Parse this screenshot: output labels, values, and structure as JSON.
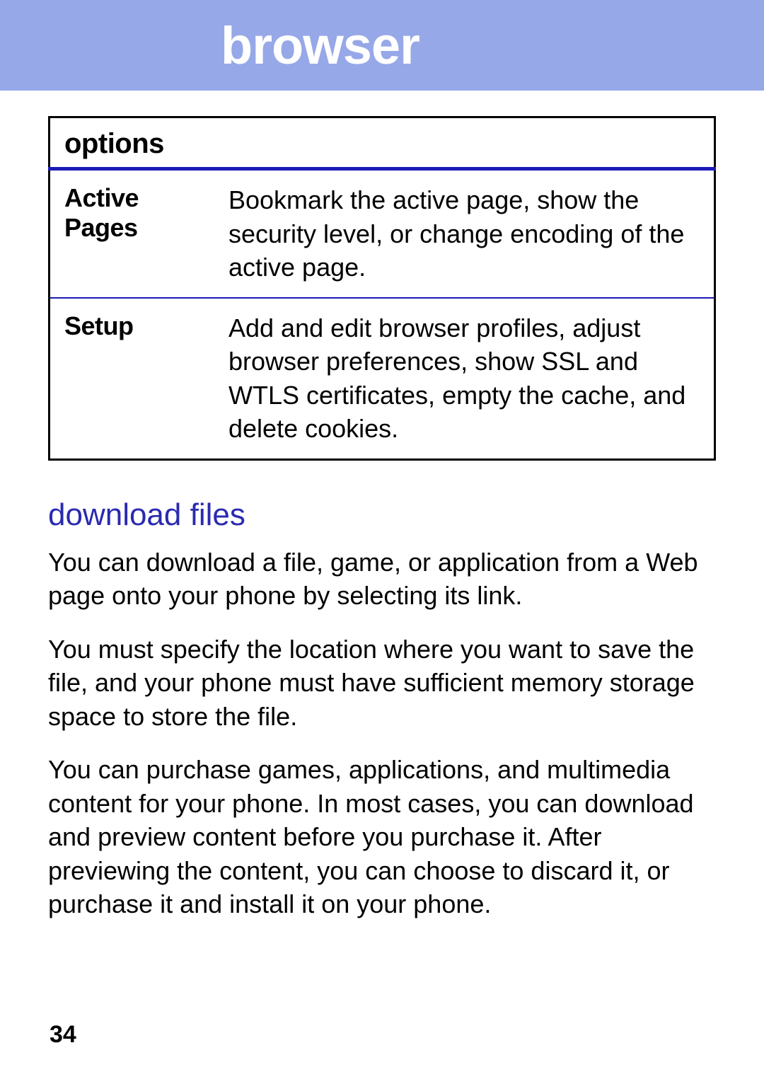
{
  "header": {
    "title": "browser"
  },
  "table": {
    "heading": "options",
    "rows": [
      {
        "label": "Active Pages",
        "description": "Bookmark the active page, show the security level, or change encoding of the active page."
      },
      {
        "label": "Setup",
        "description": "Add and edit browser profiles, adjust browser preferences, show SSL and WTLS certificates, empty the cache, and delete cookies."
      }
    ]
  },
  "section": {
    "heading": "download files",
    "paragraphs": [
      "You can download a file, game, or application from a Web page onto your phone by selecting its link.",
      "You must specify the location where you want to save the file, and your phone must have sufficient memory storage space to store the file.",
      "You can purchase games, applications, and multimedia content for your phone. In most cases, you can download and preview content before you purchase it. After previewing the content, you can choose to discard it, or purchase it and install it on your phone."
    ]
  },
  "page_number": "34"
}
